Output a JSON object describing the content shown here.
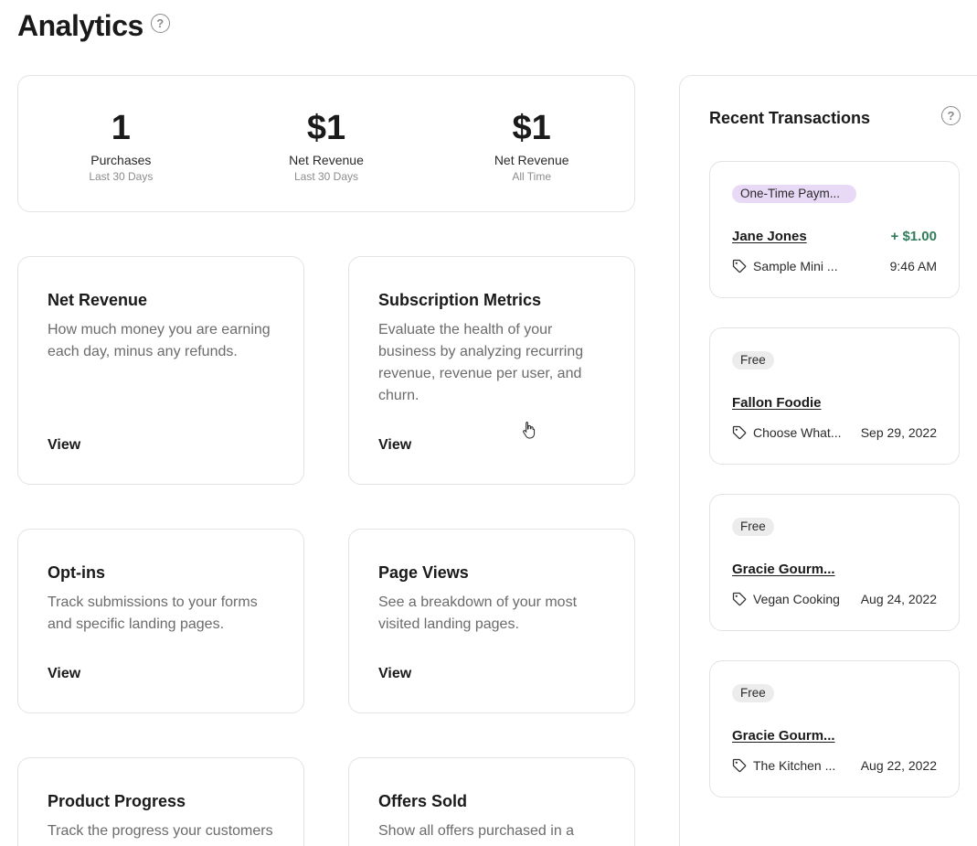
{
  "page": {
    "title": "Analytics"
  },
  "stats": [
    {
      "value": "1",
      "label": "Purchases",
      "sub": "Last 30 Days"
    },
    {
      "value": "$1",
      "label": "Net Revenue",
      "sub": "Last 30 Days"
    },
    {
      "value": "$1",
      "label": "Net Revenue",
      "sub": "All Time"
    }
  ],
  "features": [
    {
      "title": "Net Revenue",
      "description": "How much money you are earning each day, minus any refunds.",
      "action": "View"
    },
    {
      "title": "Subscription Metrics",
      "description": "Evaluate the health of your business by analyzing recurring revenue, revenue per user, and churn.",
      "action": "View"
    },
    {
      "title": "Opt-ins",
      "description": "Track submissions to your forms and specific landing pages.",
      "action": "View"
    },
    {
      "title": "Page Views",
      "description": "See a breakdown of your most visited landing pages.",
      "action": "View"
    },
    {
      "title": "Product Progress",
      "description": "Track the progress your customers",
      "action": ""
    },
    {
      "title": "Offers Sold",
      "description": "Show all offers purchased in a",
      "action": ""
    }
  ],
  "recent_transactions": {
    "title": "Recent Transactions",
    "items": [
      {
        "type": "One-Time Paym...",
        "type_style": "purple",
        "name": "Jane Jones",
        "amount": "+ $1.00",
        "product": "Sample Mini ...",
        "date": "9:46 AM"
      },
      {
        "type": "Free",
        "type_style": "gray",
        "name": "Fallon Foodie",
        "amount": "",
        "product": "Choose What...",
        "date": "Sep 29, 2022"
      },
      {
        "type": "Free",
        "type_style": "gray",
        "name": "Gracie Gourm...",
        "amount": "",
        "product": "Vegan Cooking",
        "date": "Aug 24, 2022"
      },
      {
        "type": "Free",
        "type_style": "gray",
        "name": "Gracie Gourm...",
        "amount": "",
        "product": "The Kitchen ...",
        "date": "Aug 22, 2022"
      }
    ]
  },
  "colors": {
    "accent_green": "#2f7d5a",
    "pill_purple": "#e8daf6",
    "pill_gray": "#ececec"
  }
}
